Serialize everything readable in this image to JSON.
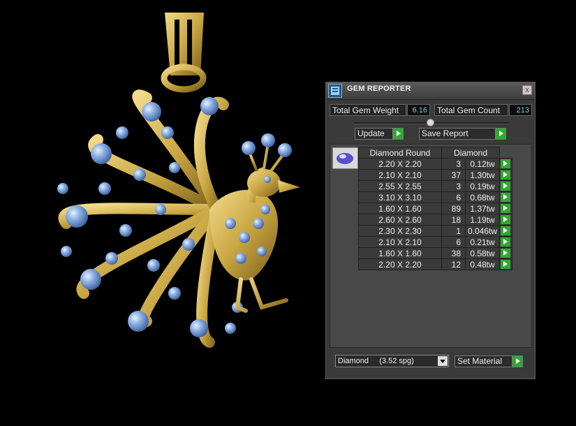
{
  "panel": {
    "title": "GEM REPORTER",
    "close_glyph": "x"
  },
  "stats": {
    "weight_label": "Total Gem Weight",
    "weight_value": "6.16",
    "count_label": "Total Gem Count",
    "count_value": "213"
  },
  "buttons": {
    "update": "Update",
    "save_report": "Save Report",
    "set_material": "Set Material"
  },
  "table": {
    "header_shape": "Diamond Round",
    "header_material": "Diamond",
    "rows": [
      {
        "size": "2.20 X 2.20",
        "count": "3",
        "weight": "0.12tw"
      },
      {
        "size": "2.10 X 2.10",
        "count": "37",
        "weight": "1.30tw"
      },
      {
        "size": "2.55 X 2.55",
        "count": "3",
        "weight": "0.19tw"
      },
      {
        "size": "3.10 X 3.10",
        "count": "6",
        "weight": "0.68tw"
      },
      {
        "size": "1.60 X 1.60",
        "count": "89",
        "weight": "1.37tw"
      },
      {
        "size": "2.60 X 2.60",
        "count": "18",
        "weight": "1.19tw"
      },
      {
        "size": "2.30 X 2.30",
        "count": "1",
        "weight": "0.046tw"
      },
      {
        "size": "2.10 X 2.10",
        "count": "6",
        "weight": "0.21tw"
      },
      {
        "size": "1.60 X 1.60",
        "count": "38",
        "weight": "0.58tw"
      },
      {
        "size": "2.20 X 2.20",
        "count": "12",
        "weight": "0.48tw"
      }
    ]
  },
  "material": {
    "selected": "Diamond     (3.52 spg)"
  },
  "colors": {
    "accent_green": "#2faa2f",
    "value_cyan": "#6ad4e0",
    "gold": "#c9a744",
    "gem_blue": "#7aa0d8"
  },
  "icons": [
    "gem-reporter-icon",
    "close-icon",
    "arrow-right-icon",
    "dropdown-arrow-icon",
    "gem-thumbnail-icon"
  ]
}
